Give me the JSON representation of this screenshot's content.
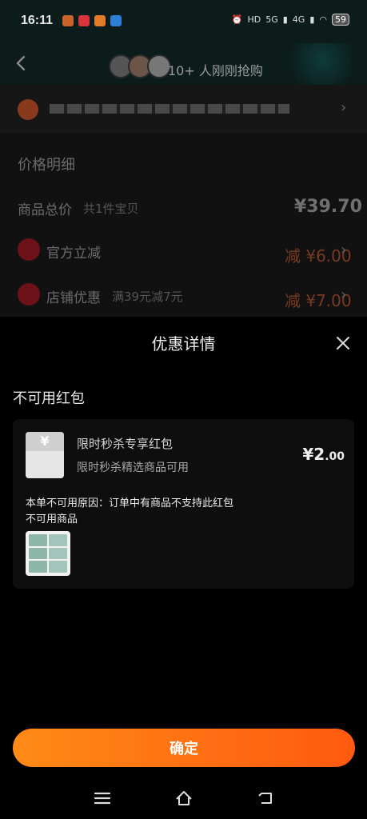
{
  "status_bar": {
    "time": "16:11",
    "signal_a": "HD",
    "network_5g": "5G",
    "network_4g": "4G",
    "battery": "59"
  },
  "header": {
    "buyers_text": "10+ 人刚刚抢购"
  },
  "background_page": {
    "price_detail_title": "价格明细",
    "total_label": "商品总价",
    "total_sub": "共1件宝贝",
    "total_price": "¥39.70",
    "official_discount_label": "官方立减",
    "official_discount_value": "减 ¥6.00",
    "store_discount_label": "店铺优惠",
    "store_discount_sub": "满39元减7元",
    "store_discount_value": "减 ¥7.00"
  },
  "modal": {
    "title": "优惠详情",
    "section_title": "不可用红包",
    "coupon": {
      "name": "限时秒杀专享红包",
      "description": "限时秒杀精选商品可用",
      "amount_symbol": "¥",
      "amount_main": "2",
      "amount_decimal": ".00",
      "envelope_symbol": "¥",
      "reason": "本单不可用原因：订单中有商品不支持此红包",
      "unavailable_label": "不可用商品"
    },
    "confirm_label": "确定"
  },
  "colors": {
    "accent_orange": "#ff7a12",
    "discount_red": "#7a3a22"
  }
}
